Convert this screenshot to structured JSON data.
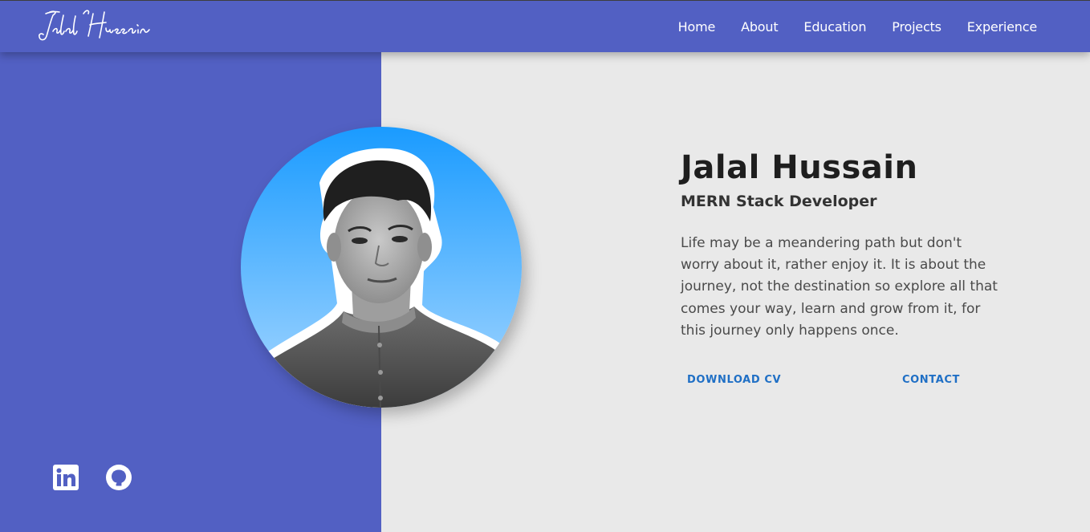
{
  "header": {
    "logo_text": "Jalal Hussain",
    "nav": [
      {
        "label": "Home"
      },
      {
        "label": "About"
      },
      {
        "label": "Education"
      },
      {
        "label": "Projects"
      },
      {
        "label": "Experience"
      }
    ]
  },
  "hero": {
    "name": "Jalal Hussain",
    "role": "MERN Stack Developer",
    "bio": "Life may be a meandering path but don't worry about it, rather enjoy it. It is about the journey, not the destination so explore all that comes your way, learn and grow from it, for this journey only happens once.",
    "download_cv_label": "DOWNLOAD CV",
    "contact_label": "CONTACT"
  },
  "socials": [
    {
      "icon": "linkedin-icon"
    },
    {
      "icon": "github-icon"
    }
  ],
  "colors": {
    "primary": "#5260c3",
    "background": "#e9e9e9",
    "accent_link": "#1f6fc5",
    "avatar_bg_top": "#1a9bff",
    "avatar_bg_bottom": "#a9d8ff"
  }
}
